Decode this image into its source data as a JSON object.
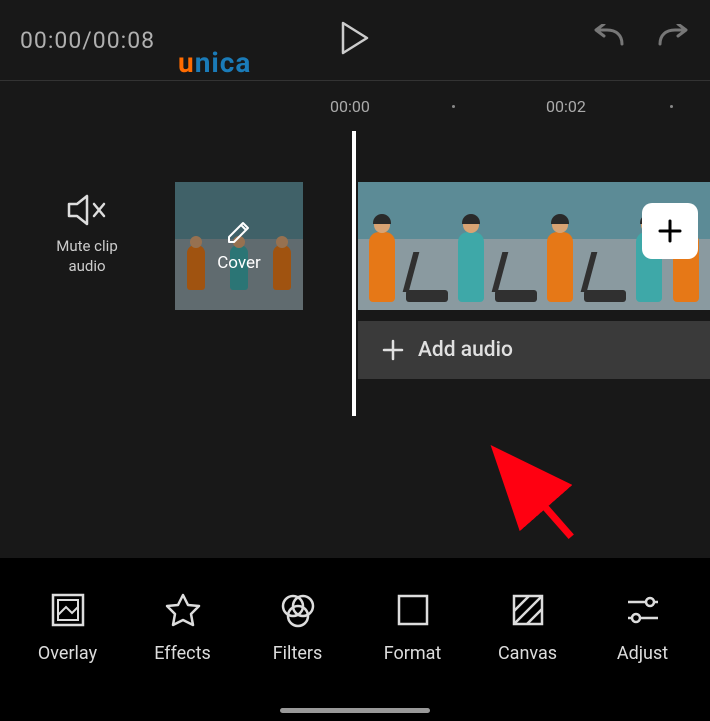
{
  "header": {
    "time_current": "00:00",
    "time_separator": "/",
    "time_total": "00:08"
  },
  "watermark": {
    "letter_u": "u",
    "rest": "nica"
  },
  "ruler": {
    "tick_1": "00:00",
    "tick_2": "00:02"
  },
  "timeline": {
    "mute_label": "Mute clip audio",
    "cover_label": "Cover",
    "add_audio_label": "Add audio"
  },
  "toolbar": {
    "overlay": "Overlay",
    "effects": "Effects",
    "filters": "Filters",
    "format": "Format",
    "canvas": "Canvas",
    "adjust": "Adjust"
  }
}
